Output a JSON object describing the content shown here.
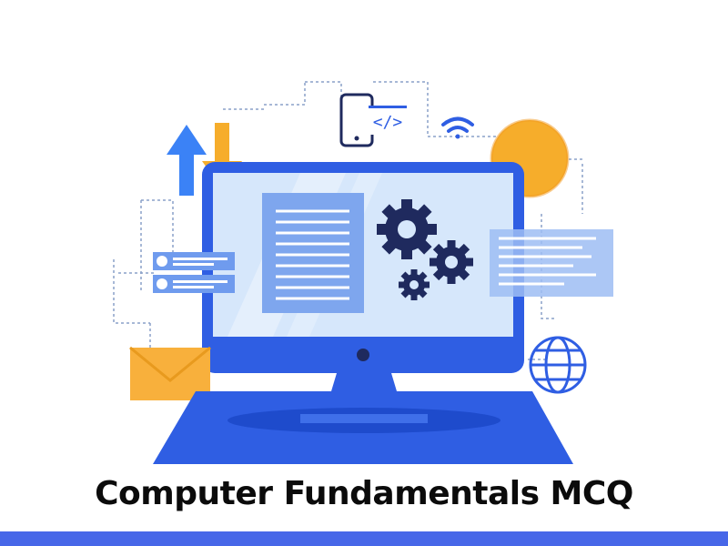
{
  "title": "Computer Fundamentals MCQ",
  "code_symbol": "</>",
  "colors": {
    "primary_blue": "#2f5ee3",
    "dark_navy": "#1f2a5e",
    "light_blue": "#dbeafe",
    "screen_blue": "#a9c6f7",
    "orange": "#f6ad2b",
    "envelope_orange": "#f8b03c",
    "bottom_bar": "#4767e8"
  },
  "icons": [
    "upload-arrow-icon",
    "download-arrow-icon",
    "smartphone-icon",
    "code-icon",
    "wifi-icon",
    "sun-circle-icon",
    "gear-icon",
    "document-icon",
    "user-card-icon",
    "envelope-icon",
    "globe-icon",
    "monitor-icon",
    "laptop-base-icon"
  ]
}
